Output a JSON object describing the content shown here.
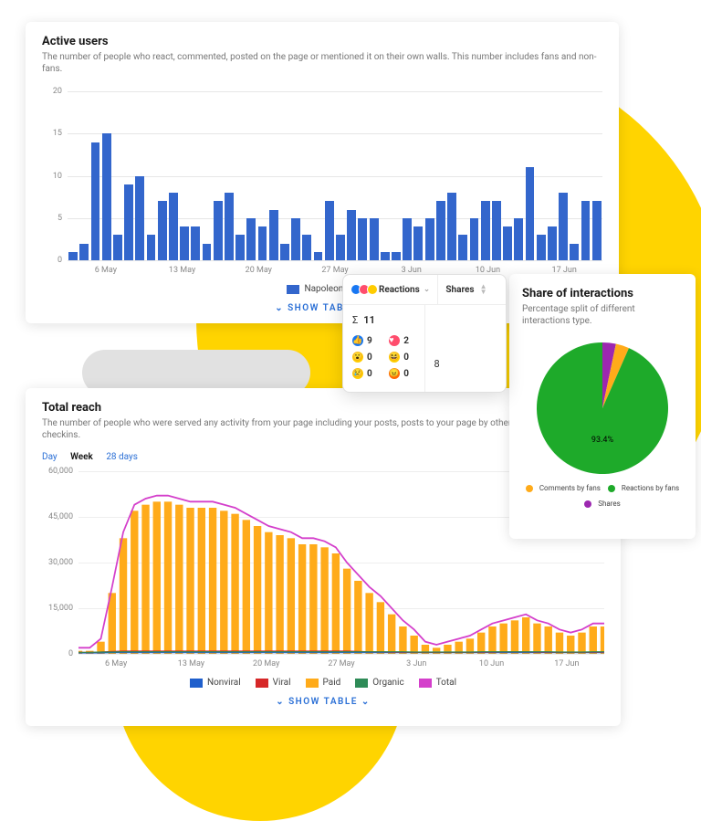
{
  "active_users": {
    "title": "Active users",
    "subtitle": "The number of people who react, commented, posted on the page or mentioned it on their own walls. This number includes fans and non-fans.",
    "legend_label": "NapoleonCat",
    "show_table": "SHOW TABLE",
    "y_ticks": [
      "0",
      "5",
      "10",
      "15",
      "20"
    ],
    "x_ticks": [
      "6 May",
      "13 May",
      "20 May",
      "27 May",
      "3 Jun",
      "10 Jun",
      "17 Jun"
    ]
  },
  "reactions_panel": {
    "col_reactions": "Reactions",
    "col_shares": "Shares",
    "sigma_label": "Σ",
    "sigma_value": "11",
    "like": "9",
    "love": "2",
    "wow": "0",
    "haha": "0",
    "sad": "0",
    "angry": "0",
    "shares_value": "8"
  },
  "share": {
    "title": "Share of interactions",
    "subtitle": "Percentage split of different interactions type.",
    "big_pct": "93.4%",
    "legend_comments": "Comments by fans",
    "legend_reactions": "Reactions by fans",
    "legend_shares": "Shares"
  },
  "total_reach": {
    "title": "Total reach",
    "subtitle": "The number of people who were served any activity from your page including your posts, posts to your page by others, ads, mentions and checkins.",
    "tab_day": "Day",
    "tab_week": "Week",
    "tab_28": "28 days",
    "y_ticks": [
      "0",
      "15,000",
      "30,000",
      "45,000",
      "60,000"
    ],
    "x_ticks": [
      "6 May",
      "13 May",
      "20 May",
      "27 May",
      "3 Jun",
      "10 Jun",
      "17 Jun"
    ],
    "legend": {
      "nonviral": "Nonviral",
      "viral": "Viral",
      "paid": "Paid",
      "organic": "Organic",
      "total": "Total"
    },
    "show_table": "SHOW TABLE"
  },
  "colors": {
    "bar": "#3366cc",
    "paid": "#ffab1a",
    "viral": "#d62728",
    "nonviral": "#1f5fcc",
    "organic": "#2e8b57",
    "total": "#d43fcb",
    "pie_reactions": "#1eaa2a",
    "pie_comments": "#ffab1a",
    "pie_shares": "#9c27b0"
  },
  "chart_data": [
    {
      "type": "bar",
      "title": "Active users",
      "ylabel": "",
      "xlabel": "",
      "ylim": [
        0,
        20
      ],
      "series": [
        {
          "name": "NapoleonCat",
          "values": [
            1,
            2,
            14,
            15,
            3,
            9,
            10,
            3,
            7,
            8,
            4,
            4,
            2,
            7,
            8,
            3,
            5,
            4,
            6,
            2,
            5,
            3,
            1,
            7,
            3,
            6,
            5,
            5,
            1,
            1,
            5,
            4,
            5,
            7,
            8,
            3,
            5,
            7,
            7,
            4,
            5,
            11,
            3,
            4,
            8,
            2,
            7,
            7
          ]
        }
      ],
      "x_tick_labels": [
        "6 May",
        "13 May",
        "20 May",
        "27 May",
        "3 Jun",
        "10 Jun",
        "17 Jun"
      ]
    },
    {
      "type": "pie",
      "title": "Share of interactions",
      "series": [
        {
          "name": "Reactions by fans",
          "value": 93.4
        },
        {
          "name": "Comments by fans",
          "value": 3.3
        },
        {
          "name": "Shares",
          "value": 3.3
        }
      ]
    },
    {
      "type": "area",
      "title": "Total reach",
      "ylim": [
        0,
        60000
      ],
      "x_tick_labels": [
        "6 May",
        "13 May",
        "20 May",
        "27 May",
        "3 Jun",
        "10 Jun",
        "17 Jun"
      ],
      "series": [
        {
          "name": "Total",
          "values": [
            2000,
            2000,
            5000,
            22000,
            40000,
            49000,
            51000,
            52000,
            52000,
            51000,
            50000,
            50000,
            50000,
            49000,
            48000,
            46000,
            44000,
            42000,
            41000,
            40000,
            38000,
            38000,
            37000,
            35000,
            30000,
            26000,
            22000,
            19000,
            15000,
            11000,
            8000,
            4000,
            3000,
            4000,
            5000,
            6000,
            8000,
            10000,
            11000,
            12000,
            13000,
            11000,
            10000,
            8000,
            7000,
            8000,
            10000,
            10000
          ]
        },
        {
          "name": "Paid",
          "values": [
            1000,
            1000,
            4000,
            20000,
            38000,
            47000,
            49000,
            50000,
            50000,
            49000,
            48000,
            48000,
            48000,
            47000,
            46000,
            44000,
            42000,
            40000,
            39000,
            38000,
            36000,
            36000,
            35000,
            33000,
            28000,
            24000,
            20000,
            17000,
            13000,
            9000,
            6000,
            3000,
            2000,
            3000,
            4000,
            5000,
            7000,
            9000,
            10000,
            11000,
            12000,
            10000,
            9000,
            7000,
            6000,
            7000,
            9000,
            9000
          ]
        },
        {
          "name": "Nonviral",
          "values": [
            300,
            300,
            300,
            400,
            400,
            400,
            400,
            400,
            400,
            400,
            400,
            400,
            400,
            400,
            400,
            400,
            400,
            400,
            400,
            400,
            400,
            400,
            400,
            400,
            400,
            400,
            400,
            400,
            400,
            400,
            400,
            400,
            400,
            400,
            400,
            400,
            400,
            400,
            400,
            400,
            400,
            400,
            400,
            400,
            400,
            400,
            400,
            400
          ]
        },
        {
          "name": "Viral",
          "values": [
            500,
            500,
            600,
            800,
            900,
            900,
            900,
            900,
            900,
            900,
            900,
            900,
            900,
            900,
            900,
            900,
            900,
            900,
            900,
            900,
            900,
            900,
            900,
            900,
            900,
            800,
            700,
            700,
            600,
            600,
            500,
            500,
            500,
            500,
            500,
            500,
            600,
            600,
            700,
            700,
            700,
            600,
            600,
            500,
            500,
            500,
            600,
            600
          ]
        },
        {
          "name": "Organic",
          "values": [
            500,
            500,
            600,
            600,
            700,
            700,
            700,
            700,
            700,
            700,
            700,
            700,
            700,
            700,
            700,
            700,
            700,
            700,
            700,
            700,
            700,
            700,
            700,
            700,
            700,
            700,
            700,
            700,
            700,
            700,
            600,
            600,
            600,
            600,
            600,
            600,
            700,
            700,
            700,
            700,
            700,
            700,
            700,
            600,
            600,
            600,
            700,
            700
          ]
        }
      ]
    }
  ]
}
